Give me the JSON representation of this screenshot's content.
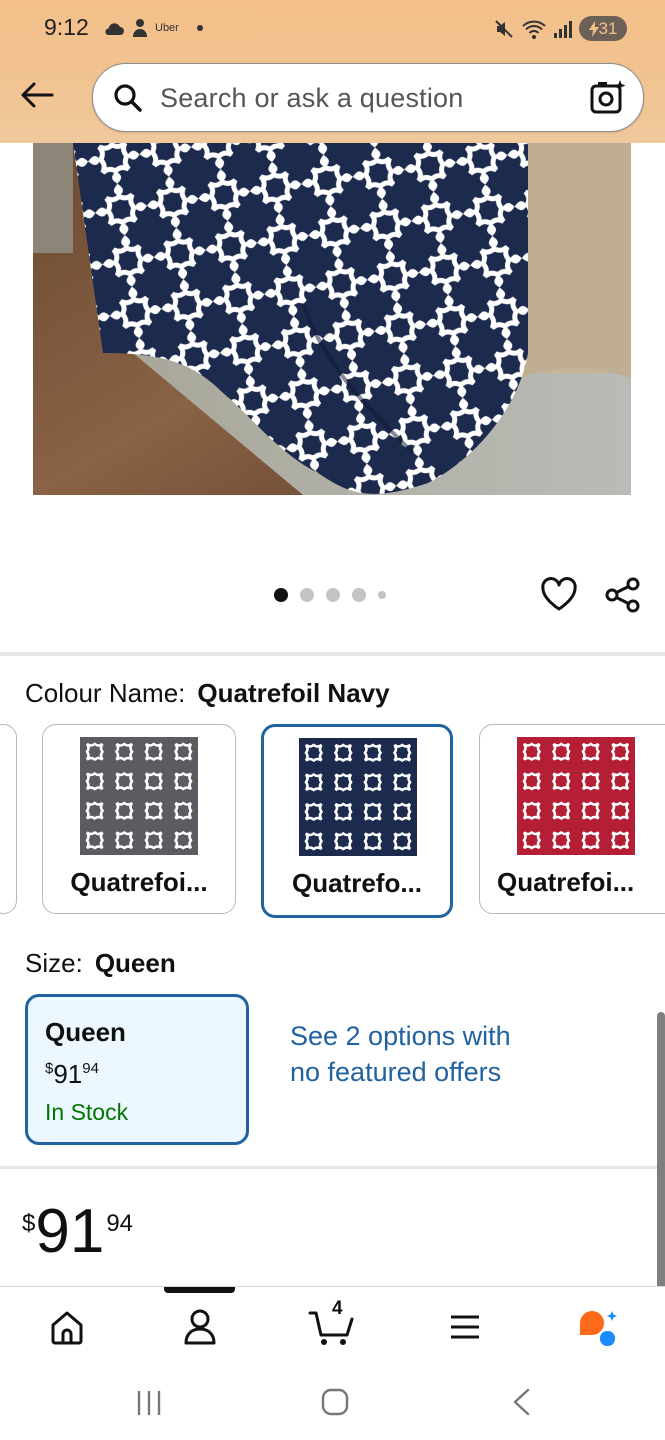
{
  "status_bar": {
    "time": "9:12",
    "app_label": "Uber",
    "battery": "31"
  },
  "header": {
    "search_placeholder": "Search or ask a question",
    "background_color": "#f3c08a"
  },
  "carousel": {
    "total": 5,
    "active_index": 0
  },
  "colour": {
    "label": "Colour Name:",
    "value": "Quatrefoil Navy",
    "options": [
      {
        "name": "Quatrefoi...",
        "color": "#5b5b62",
        "selected": false
      },
      {
        "name": "Quatrefo...",
        "color": "#1c2b4d",
        "selected": true
      },
      {
        "name": "Quatrefoi...",
        "color": "#b51f35",
        "selected": false
      }
    ]
  },
  "size": {
    "label": "Size:",
    "value": "Queen",
    "card": {
      "name": "Queen",
      "price_symbol": "$",
      "price_whole": "91",
      "price_fraction": "94",
      "stock": "In Stock"
    },
    "see_options": "See 2 options with no featured offers"
  },
  "price": {
    "symbol": "$",
    "whole": "91",
    "fraction": "94"
  },
  "bottom_nav": {
    "items": [
      "home-icon",
      "account-icon",
      "cart-icon",
      "menu-icon",
      "rufus-icon"
    ],
    "cart_count": "4",
    "active": "account-icon"
  },
  "colors": {
    "link_blue": "#2162a1",
    "in_stock_green": "#007600",
    "selected_card_bg": "#edf7ff"
  }
}
